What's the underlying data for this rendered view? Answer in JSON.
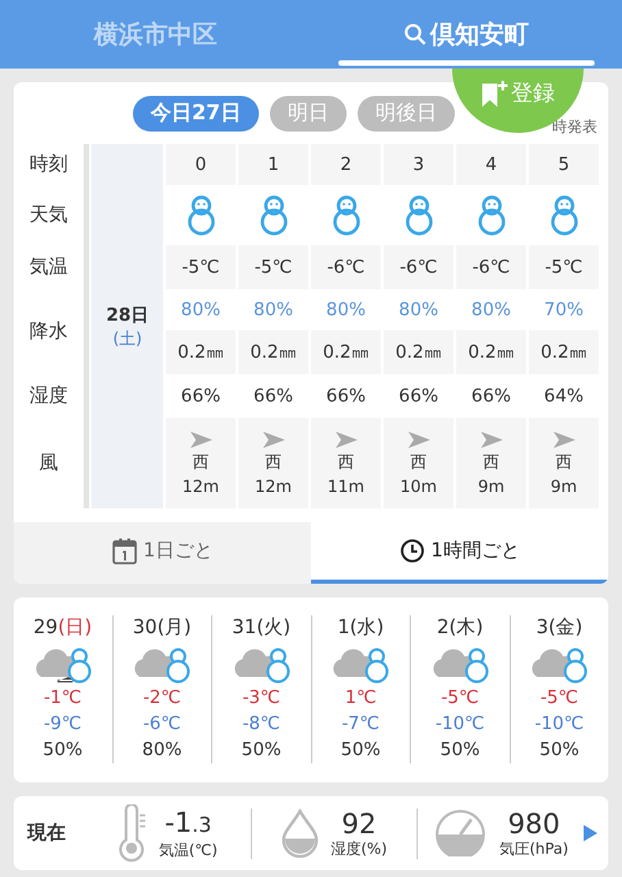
{
  "header_tabs": [
    {
      "label": "横浜市中区",
      "selected": false,
      "search": false
    },
    {
      "label": "倶知安町",
      "selected": true,
      "search": true
    }
  ],
  "register_button": {
    "label": "登録"
  },
  "hourly": {
    "day_tabs": [
      {
        "label": "今日27日",
        "selected": true
      },
      {
        "label": "明日",
        "selected": false
      },
      {
        "label": "明後日",
        "selected": false
      }
    ],
    "issued": "時発表",
    "row_labels": {
      "time": "時刻",
      "weather": "天気",
      "temp": "気温",
      "precip": "降水",
      "humidity": "湿度",
      "wind": "風"
    },
    "date": "28日",
    "weekday": "(土)",
    "hours": [
      {
        "hour": "0",
        "kind": "snow",
        "temp": "-5℃",
        "precip_chance": "80%",
        "precip_amount": "0.2㎜",
        "humidity": "66%",
        "wind_direction": "西",
        "wind_speed": "12m"
      },
      {
        "hour": "1",
        "kind": "snow",
        "temp": "-5℃",
        "precip_chance": "80%",
        "precip_amount": "0.2㎜",
        "humidity": "66%",
        "wind_direction": "西",
        "wind_speed": "12m"
      },
      {
        "hour": "2",
        "kind": "snow",
        "temp": "-6℃",
        "precip_chance": "80%",
        "precip_amount": "0.2㎜",
        "humidity": "66%",
        "wind_direction": "西",
        "wind_speed": "11m"
      },
      {
        "hour": "3",
        "kind": "snow",
        "temp": "-6℃",
        "precip_chance": "80%",
        "precip_amount": "0.2㎜",
        "humidity": "66%",
        "wind_direction": "西",
        "wind_speed": "10m"
      },
      {
        "hour": "4",
        "kind": "snow",
        "temp": "-6℃",
        "precip_chance": "80%",
        "precip_amount": "0.2㎜",
        "humidity": "66%",
        "wind_direction": "西",
        "wind_speed": "9m"
      },
      {
        "hour": "5",
        "kind": "snow",
        "temp": "-5℃",
        "precip_chance": "70%",
        "precip_amount": "0.2㎜",
        "humidity": "64%",
        "wind_direction": "西",
        "wind_speed": "9m"
      }
    ],
    "view_tabs": [
      {
        "label": "1日ごと",
        "kind": "calendar",
        "selected": false
      },
      {
        "label": "1時間ごと",
        "kind": "clock",
        "selected": true
      }
    ]
  },
  "daily": [
    {
      "date": "29",
      "weekday": "(日)",
      "sunday": true,
      "kind": "cloud_then_snow",
      "high": "-1℃",
      "low": "-9℃",
      "precip": "50%"
    },
    {
      "date": "30",
      "weekday": "(月)",
      "sunday": false,
      "kind": "cloud_snow",
      "high": "-2℃",
      "low": "-6℃",
      "precip": "80%"
    },
    {
      "date": "31",
      "weekday": "(火)",
      "sunday": false,
      "kind": "cloud_snow",
      "high": "-3℃",
      "low": "-8℃",
      "precip": "50%"
    },
    {
      "date": "1",
      "weekday": "(水)",
      "sunday": false,
      "kind": "cloud_snow",
      "high": "1℃",
      "low": "-7℃",
      "precip": "50%"
    },
    {
      "date": "2",
      "weekday": "(木)",
      "sunday": false,
      "kind": "cloud_snow",
      "high": "-5℃",
      "low": "-10℃",
      "precip": "50%"
    },
    {
      "date": "3",
      "weekday": "(金)",
      "sunday": false,
      "kind": "cloud_snow",
      "high": "-5℃",
      "low": "-10℃",
      "precip": "50%"
    }
  ],
  "current": {
    "label": "現在",
    "items": [
      {
        "kind": "thermometer",
        "value": "-1",
        "decimal": ".3",
        "label": "気温(℃)"
      },
      {
        "kind": "drop",
        "value": "92",
        "label": "湿度(%)"
      },
      {
        "kind": "gauge",
        "value": "980",
        "label": "気圧(hPa)"
      }
    ]
  }
}
